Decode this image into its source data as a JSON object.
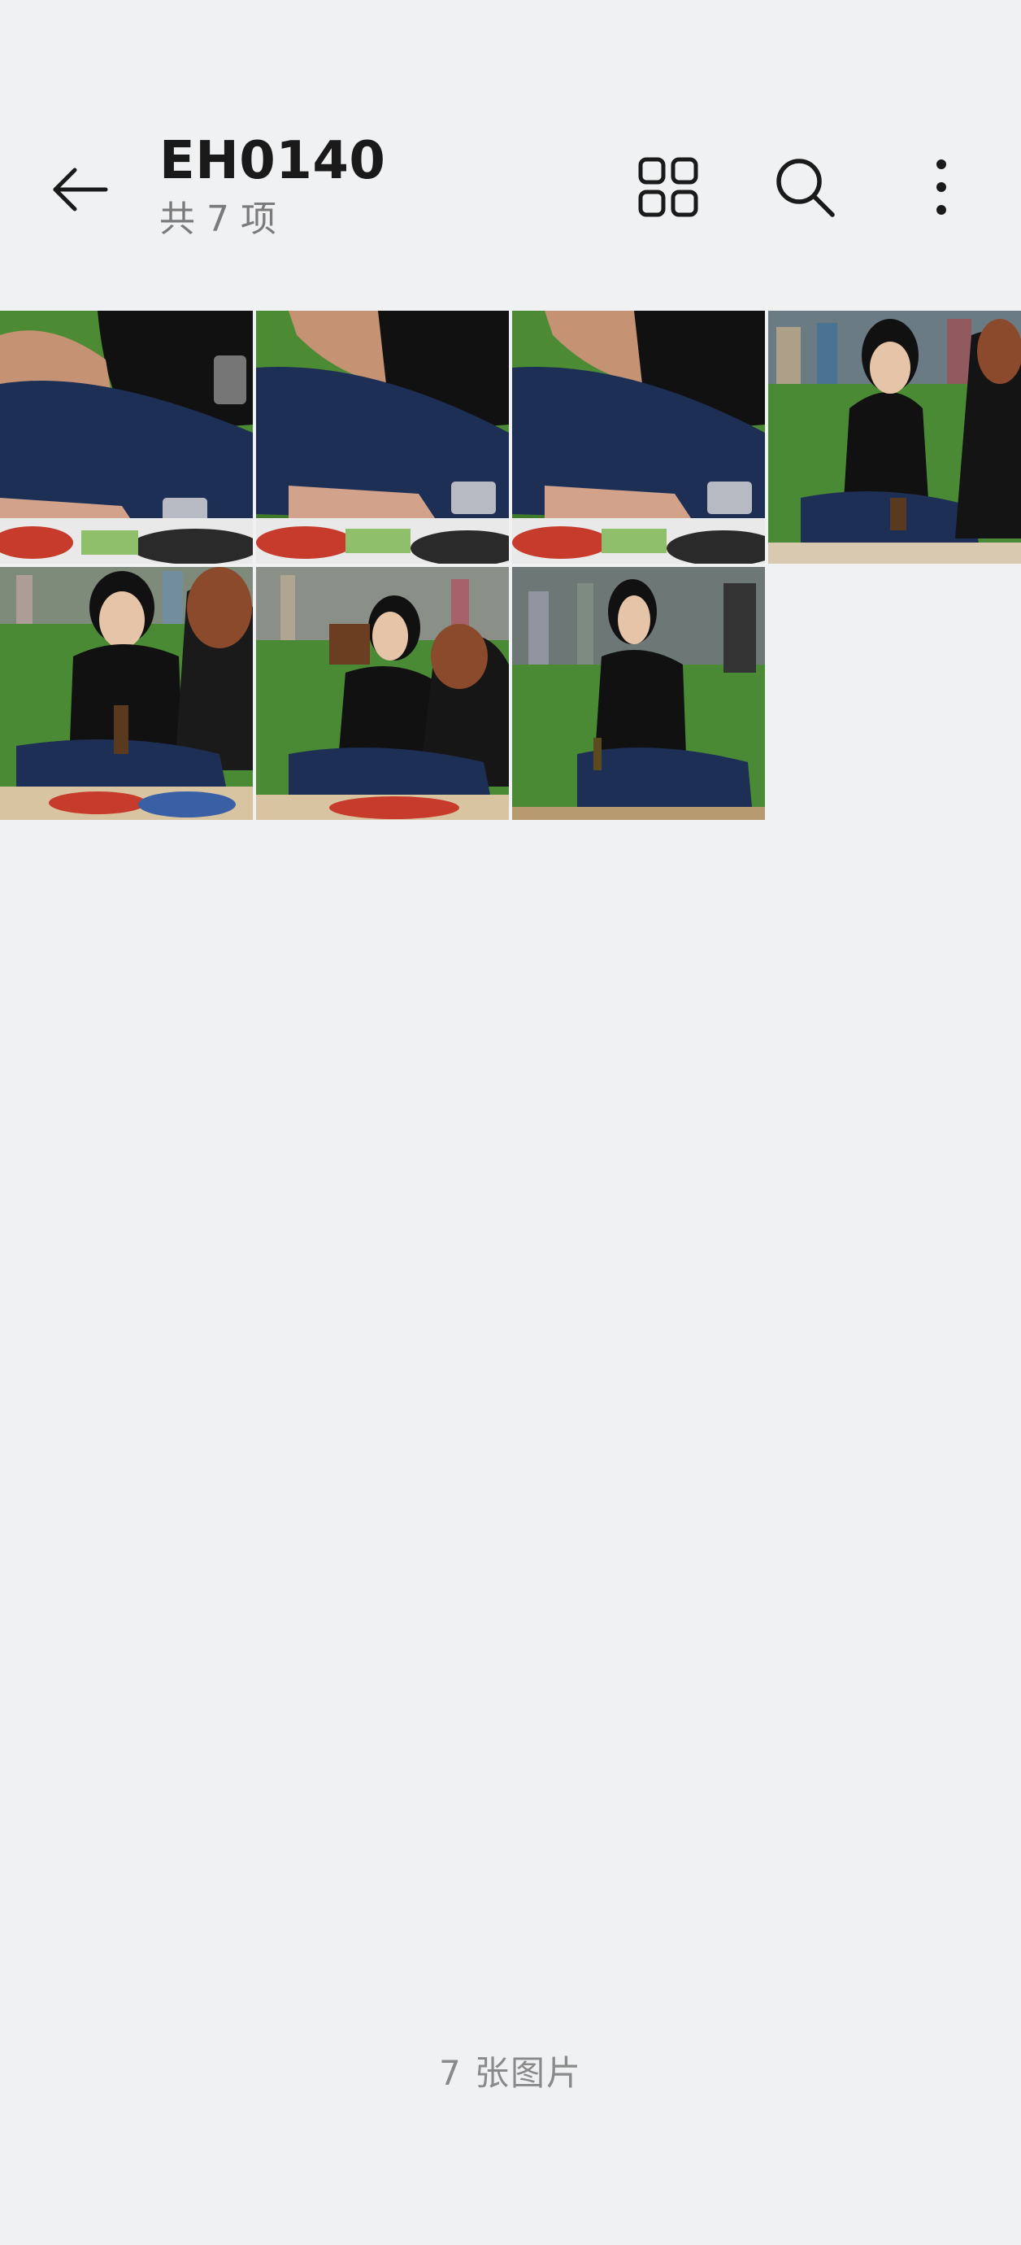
{
  "header": {
    "title": "EH0140",
    "subtitle": "共 7 项",
    "icons": {
      "back": "back-arrow-icon",
      "grid": "grid-view-icon",
      "search": "search-icon",
      "more": "more-vertical-icon"
    }
  },
  "thumbnails": [
    {
      "scene": "closeup-crossed-legs-cup"
    },
    {
      "scene": "closeup-crossed-legs-cup"
    },
    {
      "scene": "closeup-crossed-legs-cup"
    },
    {
      "scene": "woman-talking-with-glass"
    },
    {
      "scene": "two-women-sitting-wine"
    },
    {
      "scene": "two-women-bag-picnic"
    },
    {
      "scene": "woman-sitting-profile"
    }
  ],
  "footer": {
    "count_label": "7 张图片"
  }
}
